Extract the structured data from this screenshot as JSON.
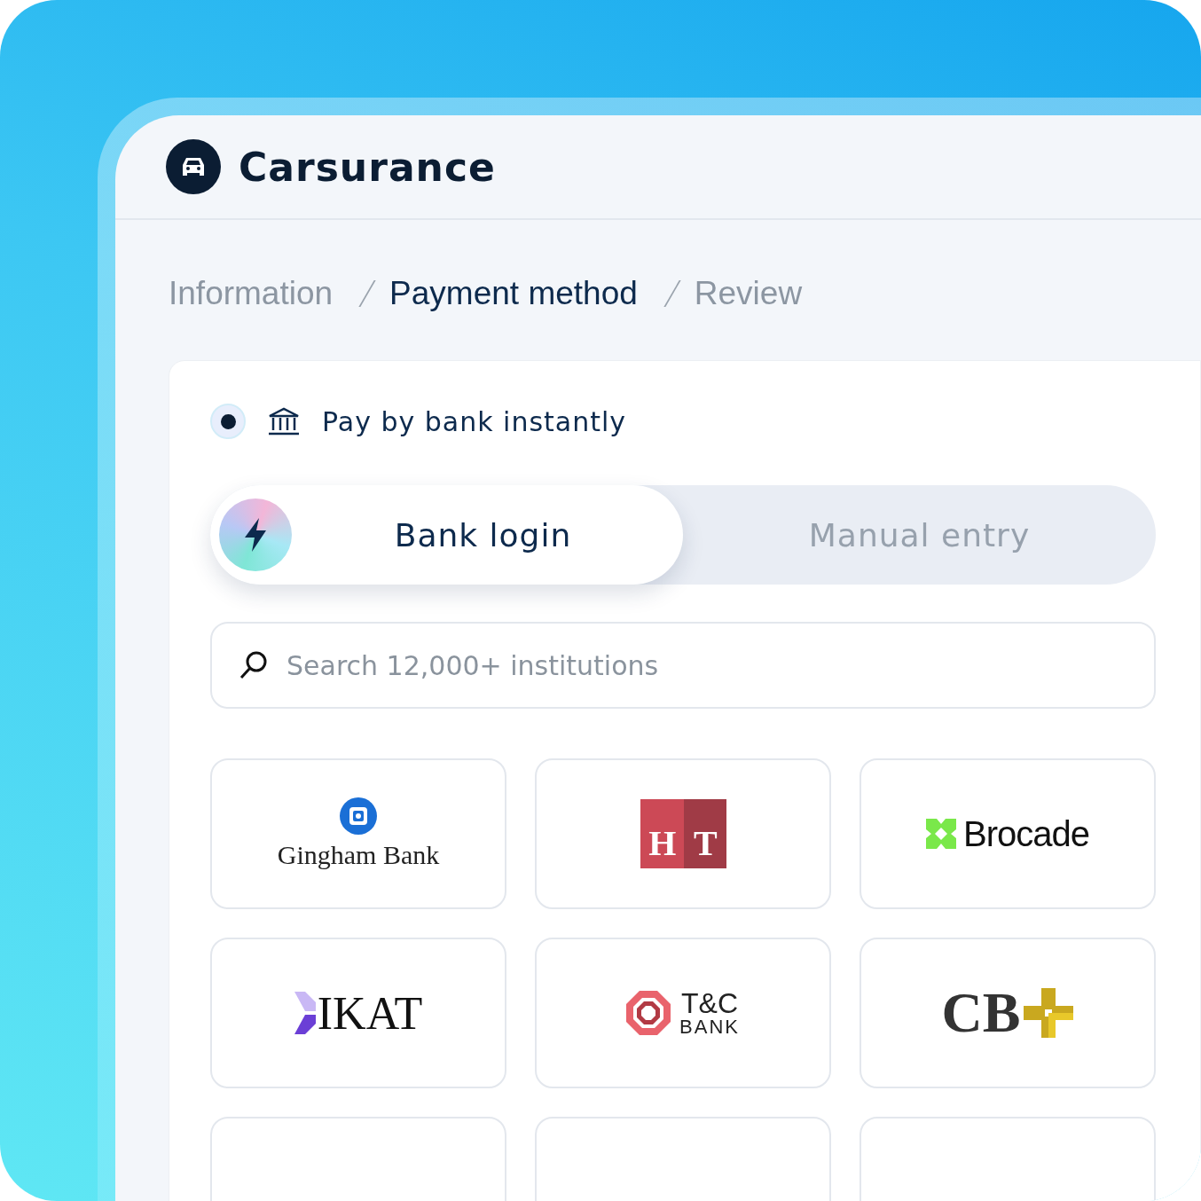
{
  "brand": {
    "name": "Carsurance"
  },
  "breadcrumb": [
    {
      "label": "Information",
      "selected": false
    },
    {
      "label": "Payment method",
      "selected": true
    },
    {
      "label": "Review",
      "selected": false
    }
  ],
  "payment_option": {
    "label": "Pay by bank instantly",
    "checked": true
  },
  "tabs": [
    {
      "label": "Bank login",
      "selected": true
    },
    {
      "label": "Manual entry",
      "selected": false
    }
  ],
  "search": {
    "placeholder": "Search 12,000+ institutions"
  },
  "banks": [
    {
      "kind": "gingham",
      "name": "Gingham Bank"
    },
    {
      "kind": "ht",
      "letters": [
        "H",
        "T"
      ]
    },
    {
      "kind": "brocade",
      "name": "Brocade"
    },
    {
      "kind": "ikat",
      "name": "IKAT"
    },
    {
      "kind": "tc",
      "lines": [
        "T&C",
        "BANK"
      ]
    },
    {
      "kind": "cb",
      "name": "CB"
    },
    {
      "kind": "blank"
    },
    {
      "kind": "blank"
    },
    {
      "kind": "blank"
    }
  ]
}
